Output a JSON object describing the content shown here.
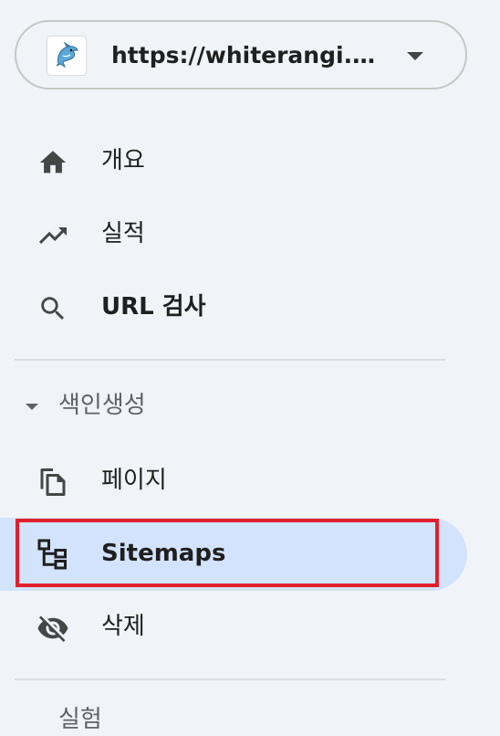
{
  "property": {
    "url": "https://whiterangi.github.io/",
    "url_display": "https://whiterangi.gi...",
    "favicon_icon": "dolphin-icon"
  },
  "nav": {
    "overview_label": "개요",
    "performance_label": "실적",
    "url_inspection_label": "URL 검사",
    "indexing_section_label": "색인생성",
    "pages_label": "페이지",
    "sitemaps_label": "Sitemaps",
    "removals_label": "삭제",
    "next_section_label": "실험"
  },
  "icons": {
    "overview": "home-icon",
    "performance": "trending-up-icon",
    "url_inspection": "search-icon",
    "pages": "copy-pages-icon",
    "sitemaps": "sitemap-icon",
    "removals": "eye-off-icon"
  },
  "colors": {
    "background": "#f0f4f9",
    "selected_background": "#d3e3fd",
    "highlight_border": "#e0202c",
    "icon": "#444746",
    "muted_text": "#5f6368"
  }
}
